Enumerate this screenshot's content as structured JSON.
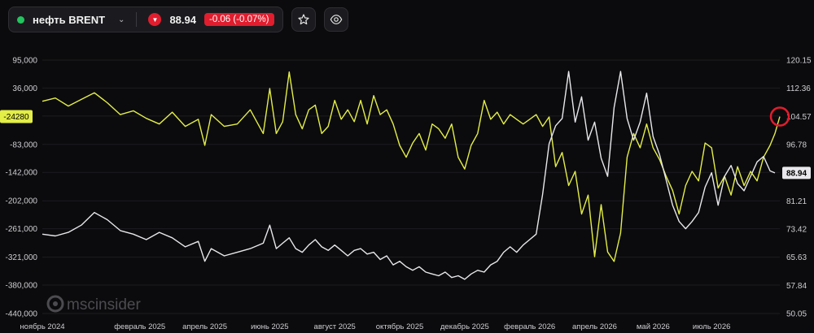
{
  "header": {
    "instrument": "нефть BRENT",
    "price": "88.94",
    "change": "-0.06 (-0.07%)"
  },
  "icons": {
    "status": "live-dot",
    "dropdown": "chevron-down-icon",
    "direction": "down-arrow-icon",
    "favorite": "star-icon",
    "watch": "eye-icon"
  },
  "colors": {
    "positions_line": "#e3ee47",
    "price_line": "#e8e8ec",
    "negative": "#e11d2e",
    "live": "#22c55e",
    "marker": "#e11d2e"
  },
  "watermark": {
    "text": "mscinsider"
  },
  "chart_data": {
    "type": "line",
    "x_ticks": [
      "ноябрь 2024",
      "февраль 2025",
      "апрель 2025",
      "июнь 2025",
      "август 2025",
      "октябрь 2025",
      "декабрь 2025",
      "февраль 2026",
      "апрель 2026",
      "май 2026",
      "июль 2026"
    ],
    "x_tick_pos": [
      0,
      3,
      5,
      7,
      9,
      11,
      13,
      15,
      17,
      18.8,
      20.6
    ],
    "x_range": [
      0,
      22.7
    ],
    "y_left": {
      "range": [
        -440000,
        95000
      ],
      "ticks": [
        95000,
        36000,
        -23000,
        -83000,
        -142000,
        -202000,
        -261000,
        -321000,
        -380000,
        -440000
      ],
      "tick_labels": [
        "95,000",
        "36,000",
        "",
        "-83,000",
        "-142,000",
        "-202,000",
        "-261,000",
        "-321,000",
        "-380,000",
        "-440,000"
      ]
    },
    "y_right": {
      "range": [
        50.05,
        120.15
      ],
      "ticks": [
        120.15,
        112.36,
        104.57,
        96.78,
        89.0,
        81.21,
        73.42,
        65.63,
        57.84,
        50.05
      ],
      "tick_labels": [
        "120.15",
        "112.36",
        "104.57",
        "96.78",
        "",
        "81.21",
        "73.42",
        "65.63",
        "57.84",
        "50.05"
      ]
    },
    "current_marks": {
      "left": "-24280",
      "left_value": -24280,
      "right": "88.94",
      "right_value": 88.94
    },
    "series": [
      {
        "axis": "left",
        "points": [
          [
            0,
            8000
          ],
          [
            0.4,
            15000
          ],
          [
            0.8,
            -2000
          ],
          [
            1.2,
            12000
          ],
          [
            1.6,
            26000
          ],
          [
            2.0,
            5000
          ],
          [
            2.4,
            -20000
          ],
          [
            2.8,
            -12000
          ],
          [
            3.2,
            -28000
          ],
          [
            3.6,
            -40000
          ],
          [
            4.0,
            -15000
          ],
          [
            4.4,
            -45000
          ],
          [
            4.8,
            -30000
          ],
          [
            5.0,
            -85000
          ],
          [
            5.2,
            -20000
          ],
          [
            5.6,
            -45000
          ],
          [
            6.0,
            -40000
          ],
          [
            6.4,
            -10000
          ],
          [
            6.8,
            -60000
          ],
          [
            7.0,
            35000
          ],
          [
            7.2,
            -60000
          ],
          [
            7.4,
            -35000
          ],
          [
            7.6,
            70000
          ],
          [
            7.8,
            -20000
          ],
          [
            8.0,
            -50000
          ],
          [
            8.2,
            -10000
          ],
          [
            8.4,
            0
          ],
          [
            8.6,
            -60000
          ],
          [
            8.8,
            -45000
          ],
          [
            9.0,
            10000
          ],
          [
            9.2,
            -30000
          ],
          [
            9.4,
            -10000
          ],
          [
            9.6,
            -35000
          ],
          [
            9.8,
            10000
          ],
          [
            10.0,
            -40000
          ],
          [
            10.2,
            20000
          ],
          [
            10.4,
            -20000
          ],
          [
            10.6,
            -10000
          ],
          [
            10.8,
            -40000
          ],
          [
            11.0,
            -85000
          ],
          [
            11.2,
            -110000
          ],
          [
            11.4,
            -80000
          ],
          [
            11.6,
            -60000
          ],
          [
            11.8,
            -95000
          ],
          [
            12.0,
            -40000
          ],
          [
            12.2,
            -50000
          ],
          [
            12.4,
            -70000
          ],
          [
            12.6,
            -40000
          ],
          [
            12.8,
            -110000
          ],
          [
            13.0,
            -135000
          ],
          [
            13.2,
            -85000
          ],
          [
            13.4,
            -60000
          ],
          [
            13.6,
            10000
          ],
          [
            13.8,
            -30000
          ],
          [
            14.0,
            -15000
          ],
          [
            14.2,
            -40000
          ],
          [
            14.4,
            -20000
          ],
          [
            14.6,
            -30000
          ],
          [
            14.8,
            -40000
          ],
          [
            15.0,
            -30000
          ],
          [
            15.2,
            -20000
          ],
          [
            15.4,
            -45000
          ],
          [
            15.6,
            -25000
          ],
          [
            15.8,
            -130000
          ],
          [
            16.0,
            -100000
          ],
          [
            16.2,
            -170000
          ],
          [
            16.4,
            -140000
          ],
          [
            16.6,
            -230000
          ],
          [
            16.8,
            -190000
          ],
          [
            17.0,
            -320000
          ],
          [
            17.2,
            -210000
          ],
          [
            17.4,
            -310000
          ],
          [
            17.6,
            -330000
          ],
          [
            17.8,
            -270000
          ],
          [
            18.0,
            -110000
          ],
          [
            18.2,
            -60000
          ],
          [
            18.4,
            -90000
          ],
          [
            18.6,
            -40000
          ],
          [
            18.8,
            -90000
          ],
          [
            19.0,
            -115000
          ],
          [
            19.2,
            -150000
          ],
          [
            19.4,
            -180000
          ],
          [
            19.6,
            -230000
          ],
          [
            19.8,
            -170000
          ],
          [
            20.0,
            -140000
          ],
          [
            20.2,
            -160000
          ],
          [
            20.4,
            -80000
          ],
          [
            20.6,
            -90000
          ],
          [
            20.8,
            -175000
          ],
          [
            21.0,
            -150000
          ],
          [
            21.2,
            -190000
          ],
          [
            21.4,
            -130000
          ],
          [
            21.6,
            -170000
          ],
          [
            21.8,
            -140000
          ],
          [
            22.0,
            -160000
          ],
          [
            22.2,
            -110000
          ],
          [
            22.4,
            -85000
          ],
          [
            22.55,
            -60000
          ],
          [
            22.7,
            -24280
          ]
        ]
      },
      {
        "axis": "right",
        "points": [
          [
            0,
            72.0
          ],
          [
            0.4,
            71.5
          ],
          [
            0.8,
            72.5
          ],
          [
            1.2,
            74.5
          ],
          [
            1.6,
            78.0
          ],
          [
            2.0,
            76.0
          ],
          [
            2.4,
            73.0
          ],
          [
            2.8,
            72.0
          ],
          [
            3.2,
            70.5
          ],
          [
            3.6,
            72.5
          ],
          [
            4.0,
            71.0
          ],
          [
            4.4,
            68.5
          ],
          [
            4.8,
            70.0
          ],
          [
            5.0,
            64.5
          ],
          [
            5.2,
            68.0
          ],
          [
            5.6,
            66.0
          ],
          [
            6.0,
            67.0
          ],
          [
            6.4,
            68.0
          ],
          [
            6.8,
            69.5
          ],
          [
            7.0,
            74.5
          ],
          [
            7.2,
            68.0
          ],
          [
            7.4,
            69.5
          ],
          [
            7.6,
            71.0
          ],
          [
            7.8,
            68.0
          ],
          [
            8.0,
            67.0
          ],
          [
            8.2,
            69.0
          ],
          [
            8.4,
            70.5
          ],
          [
            8.6,
            68.5
          ],
          [
            8.8,
            67.5
          ],
          [
            9.0,
            69.0
          ],
          [
            9.2,
            67.5
          ],
          [
            9.4,
            66.0
          ],
          [
            9.6,
            67.5
          ],
          [
            9.8,
            68.0
          ],
          [
            10.0,
            66.5
          ],
          [
            10.2,
            67.0
          ],
          [
            10.4,
            65.0
          ],
          [
            10.6,
            66.0
          ],
          [
            10.8,
            63.5
          ],
          [
            11.0,
            64.5
          ],
          [
            11.2,
            63.0
          ],
          [
            11.4,
            62.0
          ],
          [
            11.6,
            63.0
          ],
          [
            11.8,
            61.5
          ],
          [
            12.0,
            61.0
          ],
          [
            12.2,
            60.5
          ],
          [
            12.4,
            61.5
          ],
          [
            12.6,
            60.0
          ],
          [
            12.8,
            60.5
          ],
          [
            13.0,
            59.5
          ],
          [
            13.2,
            61.0
          ],
          [
            13.4,
            62.0
          ],
          [
            13.6,
            61.5
          ],
          [
            13.8,
            63.5
          ],
          [
            14.0,
            64.5
          ],
          [
            14.2,
            67.0
          ],
          [
            14.4,
            68.5
          ],
          [
            14.6,
            67.0
          ],
          [
            14.8,
            69.0
          ],
          [
            15.0,
            70.5
          ],
          [
            15.2,
            72.0
          ],
          [
            15.4,
            83.0
          ],
          [
            15.6,
            97.0
          ],
          [
            15.8,
            102.0
          ],
          [
            16.0,
            104.0
          ],
          [
            16.2,
            117.0
          ],
          [
            16.4,
            103.0
          ],
          [
            16.6,
            110.0
          ],
          [
            16.8,
            98.0
          ],
          [
            17.0,
            103.0
          ],
          [
            17.2,
            93.0
          ],
          [
            17.4,
            88.0
          ],
          [
            17.6,
            107.0
          ],
          [
            17.8,
            117.0
          ],
          [
            18.0,
            104.0
          ],
          [
            18.2,
            98.0
          ],
          [
            18.4,
            103.0
          ],
          [
            18.6,
            111.0
          ],
          [
            18.8,
            99.0
          ],
          [
            19.0,
            94.0
          ],
          [
            19.2,
            87.0
          ],
          [
            19.4,
            80.0
          ],
          [
            19.6,
            75.5
          ],
          [
            19.8,
            73.5
          ],
          [
            20.0,
            75.5
          ],
          [
            20.2,
            78.0
          ],
          [
            20.4,
            85.0
          ],
          [
            20.6,
            89.0
          ],
          [
            20.8,
            80.0
          ],
          [
            21.0,
            88.0
          ],
          [
            21.2,
            91.0
          ],
          [
            21.4,
            86.0
          ],
          [
            21.6,
            84.0
          ],
          [
            21.8,
            88.0
          ],
          [
            22.0,
            92.0
          ],
          [
            22.2,
            93.5
          ],
          [
            22.4,
            89.5
          ],
          [
            22.55,
            88.94
          ]
        ]
      }
    ]
  }
}
